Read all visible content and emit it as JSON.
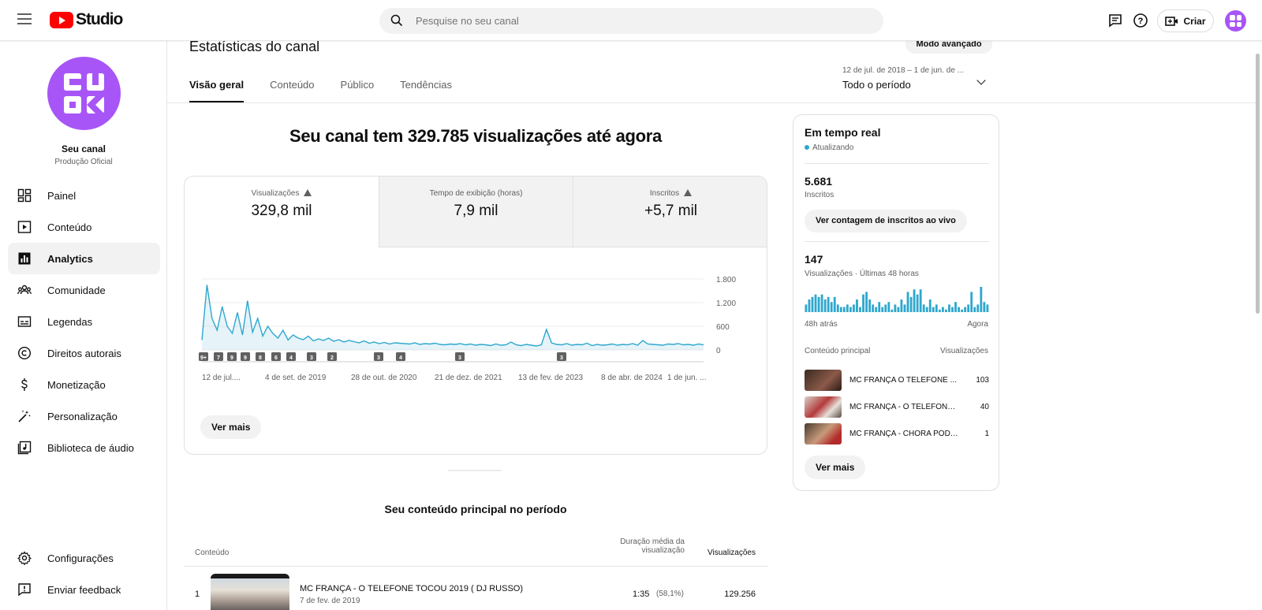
{
  "app": {
    "logo_text": "Studio"
  },
  "search": {
    "placeholder": "Pesquise no seu canal"
  },
  "header": {
    "create_label": "Criar"
  },
  "sidebar": {
    "channel_name": "Seu canal",
    "channel_subtitle": "Produção Oficial",
    "items": [
      {
        "label": "Painel",
        "icon": "dashboard-icon"
      },
      {
        "label": "Conteúdo",
        "icon": "content-icon"
      },
      {
        "label": "Analytics",
        "icon": "analytics-icon"
      },
      {
        "label": "Comunidade",
        "icon": "community-icon"
      },
      {
        "label": "Legendas",
        "icon": "subtitles-icon"
      },
      {
        "label": "Direitos autorais",
        "icon": "copyright-icon"
      },
      {
        "label": "Monetização",
        "icon": "monetization-icon"
      },
      {
        "label": "Personalização",
        "icon": "customization-icon"
      },
      {
        "label": "Biblioteca de áudio",
        "icon": "audio-library-icon"
      }
    ],
    "bottom": [
      {
        "label": "Configurações",
        "icon": "settings-icon"
      },
      {
        "label": "Enviar feedback",
        "icon": "feedback-icon"
      }
    ]
  },
  "page": {
    "title": "Estatísticas do canal",
    "advanced_mode": "Modo avançado",
    "tabs": [
      "Visão geral",
      "Conteúdo",
      "Público",
      "Tendências"
    ],
    "date_range_small": "12 de jul. de 2018 – 1 de jun. de ...",
    "date_range_main": "Todo o período",
    "headline": "Seu canal tem 329.785 visualizações até agora"
  },
  "metrics": [
    {
      "label": "Visualizações",
      "value": "329,8 mil",
      "warning": true
    },
    {
      "label": "Tempo de exibição (horas)",
      "value": "7,9 mil",
      "warning": false
    },
    {
      "label": "Inscritos",
      "value": "+5,7 mil",
      "warning": true
    }
  ],
  "chart_data": {
    "type": "line",
    "ylim": [
      0,
      1800
    ],
    "yticks": [
      "1.800",
      "1.200",
      "600",
      "0"
    ],
    "xticks": [
      "12 de jul....",
      "4 de set. de 2019",
      "28 de out. de 2020",
      "21 de dez. de 2021",
      "13 de fev. de 2023",
      "8 de abr. de 2024",
      "1 de jun. ..."
    ],
    "markers": [
      "9+",
      "7",
      "9",
      "9",
      "8",
      "6",
      "4",
      "3",
      "2",
      "3",
      "4",
      "3",
      "3"
    ],
    "color": "#2ea7ce",
    "series": [
      {
        "values": [
          250,
          1650,
          800,
          500,
          1100,
          600,
          420,
          950,
          380,
          1250,
          450,
          800,
          350,
          600,
          420,
          300,
          500,
          250,
          380,
          300,
          260,
          350,
          230,
          280,
          240,
          300,
          220,
          260,
          200,
          240,
          210,
          180,
          230,
          170,
          200,
          160,
          190,
          150,
          180,
          170,
          160,
          150,
          180,
          140,
          160,
          150,
          170,
          140,
          130,
          150,
          140,
          160,
          130,
          150,
          120,
          140,
          130,
          110,
          150,
          120,
          130,
          200,
          130,
          110,
          140,
          120,
          100,
          130,
          520,
          180,
          140,
          130,
          160,
          120,
          140,
          130,
          170,
          110,
          140,
          120,
          130,
          150,
          120,
          140,
          130,
          160,
          120,
          240,
          150,
          140,
          130,
          120,
          150,
          140,
          160,
          130,
          140,
          120,
          150,
          130
        ]
      }
    ]
  },
  "overview": {
    "see_more": "Ver mais"
  },
  "realtime": {
    "title": "Em tempo real",
    "status": "Atualizando",
    "subs_value": "5.681",
    "subs_label": "Inscritos",
    "live_count_btn": "Ver contagem de inscritos ao vivo",
    "views_value": "147",
    "views_label": "Visualizações · Últimas 48 horas",
    "axis_start": "48h atrás",
    "axis_end": "Agora",
    "bars": [
      3,
      5,
      6,
      7,
      6,
      7,
      5,
      6,
      4,
      6,
      3,
      2,
      2,
      3,
      2,
      3,
      5,
      2,
      7,
      8,
      5,
      3,
      2,
      4,
      2,
      3,
      4,
      1,
      3,
      2,
      5,
      3,
      8,
      6,
      9,
      7,
      9,
      3,
      2,
      5,
      2,
      3,
      1,
      2,
      1,
      3,
      2,
      4,
      2,
      1,
      2,
      3,
      8,
      2,
      3,
      10,
      4,
      3
    ],
    "header_content": "Conteúdo principal",
    "header_views": "Visualizações",
    "rows": [
      {
        "title": "MC FRANÇA O TELEFONE ...",
        "views": "103"
      },
      {
        "title": "MC FRANÇA - O TELEFONE ...",
        "views": "40"
      },
      {
        "title": "MC FRANÇA - CHORA PODE ...",
        "views": "1"
      }
    ],
    "see_more": "Ver mais"
  },
  "top_content": {
    "title": "Seu conteúdo principal no período",
    "col_content": "Conteúdo",
    "col_avg_duration_1": "Duração média da",
    "col_avg_duration_2": "visualização",
    "col_views": "Visualizações",
    "rows": [
      {
        "rank": "1",
        "title": "MC FRANÇA - O TELEFONE TOCOU 2019 ( DJ RUSSO)",
        "date": "7 de fev. de 2019",
        "duration": "1:35",
        "pct": "(58,1%)",
        "views": "129.256"
      }
    ]
  }
}
